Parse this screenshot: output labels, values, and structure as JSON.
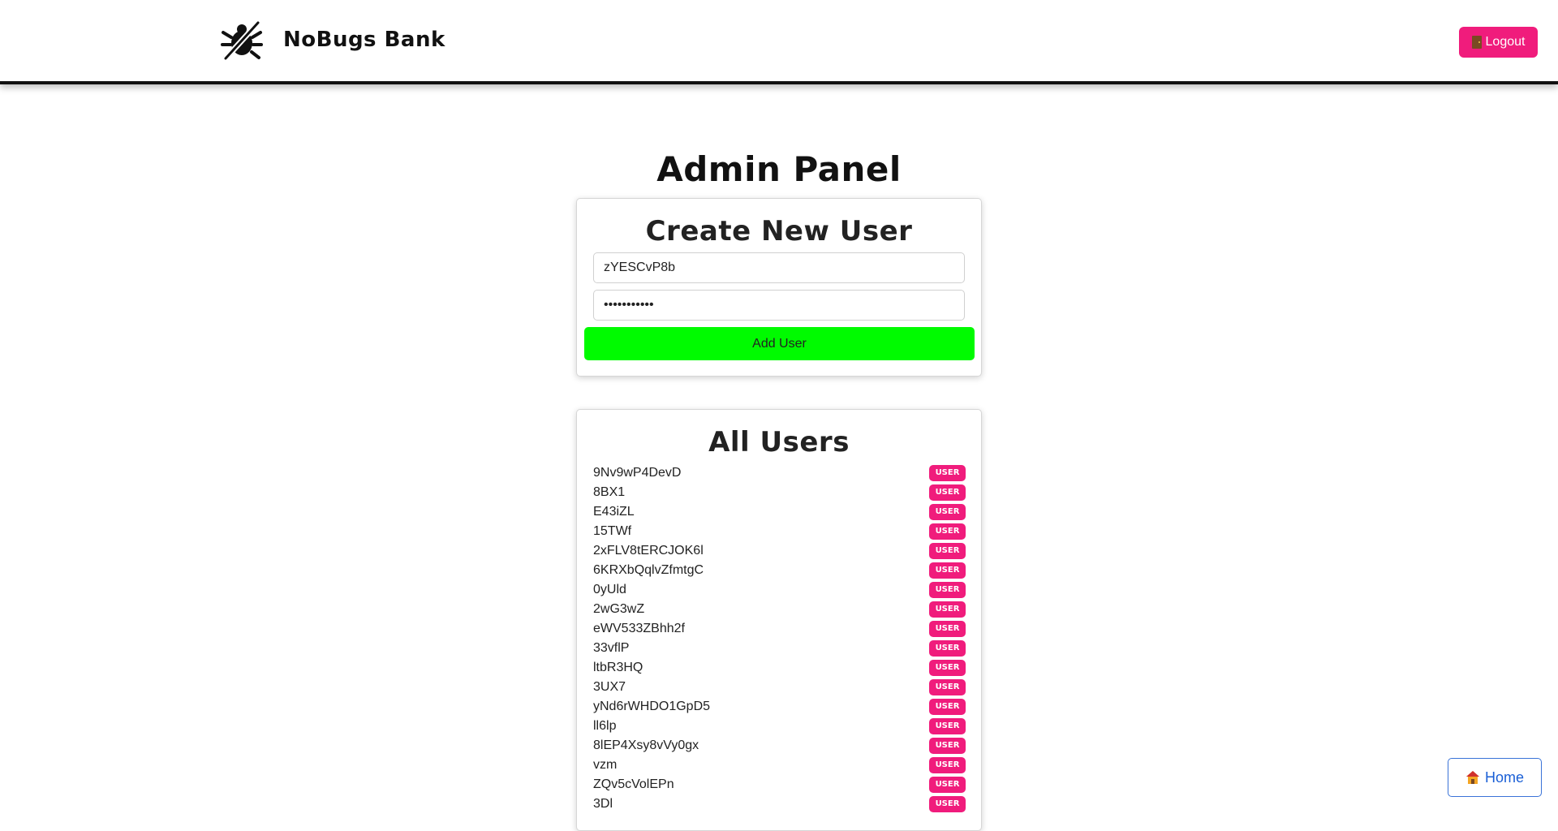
{
  "header": {
    "brand_name": "NoBugs Bank",
    "logo_icon": "crossed-bug-icon",
    "logout_label": "Logout",
    "logout_icon": "door-icon"
  },
  "page": {
    "title": "Admin Panel"
  },
  "create_user": {
    "title": "Create New User",
    "username_value": "zYESCvP8b",
    "password_value": "•••••••••••",
    "add_button_label": "Add User"
  },
  "all_users": {
    "title": "All Users",
    "users": [
      {
        "name": "9Nv9wP4DevD",
        "role": "USER"
      },
      {
        "name": "8BX1",
        "role": "USER"
      },
      {
        "name": "E43iZL",
        "role": "USER"
      },
      {
        "name": "15TWf",
        "role": "USER"
      },
      {
        "name": "2xFLV8tERCJOK6l",
        "role": "USER"
      },
      {
        "name": "6KRXbQqlvZfmtgC",
        "role": "USER"
      },
      {
        "name": "0yUld",
        "role": "USER"
      },
      {
        "name": "2wG3wZ",
        "role": "USER"
      },
      {
        "name": "eWV533ZBhh2f",
        "role": "USER"
      },
      {
        "name": "33vflP",
        "role": "USER"
      },
      {
        "name": "ltbR3HQ",
        "role": "USER"
      },
      {
        "name": "3UX7",
        "role": "USER"
      },
      {
        "name": "yNd6rWHDO1GpD5",
        "role": "USER"
      },
      {
        "name": "ll6lp",
        "role": "USER"
      },
      {
        "name": "8lEP4Xsy8vVy0gx",
        "role": "USER"
      },
      {
        "name": "vzm",
        "role": "USER"
      },
      {
        "name": "ZQv5cVolEPn",
        "role": "USER"
      },
      {
        "name": "3Dl",
        "role": "USER"
      }
    ]
  },
  "home_button": {
    "label": "Home",
    "icon": "house-icon"
  },
  "colors": {
    "accent_pink": "#f01c7c",
    "add_green": "#00fb00",
    "home_blue": "#1a5fd6",
    "text_dark": "#111111"
  }
}
